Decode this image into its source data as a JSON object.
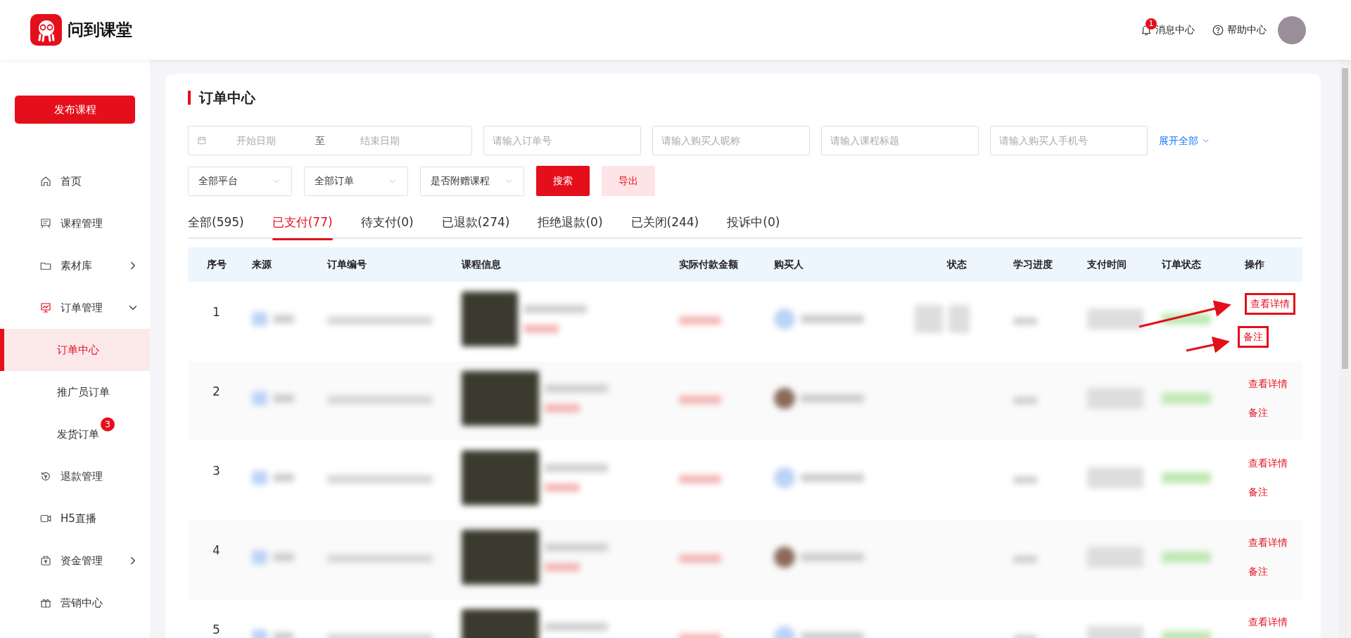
{
  "header": {
    "logo_text": "问到课堂",
    "notifications": {
      "label": "消息中心",
      "badge": "1"
    },
    "help": {
      "label": "帮助中心"
    }
  },
  "sidebar": {
    "publish_button": "发布课程",
    "items": [
      {
        "kind": "link",
        "label": "首页",
        "selected": false
      },
      {
        "kind": "link",
        "label": "课程管理",
        "selected": false
      },
      {
        "kind": "group",
        "label": "素材库",
        "selected": false,
        "expanded": false
      },
      {
        "kind": "group",
        "label": "订单管理",
        "selected": false,
        "expanded": true,
        "children": [
          {
            "label": "订单中心",
            "selected": true
          },
          {
            "label": "推广员订单",
            "selected": false
          },
          {
            "label": "发货订单",
            "selected": false,
            "badge": "3"
          }
        ]
      },
      {
        "kind": "link",
        "label": "退款管理",
        "selected": false
      },
      {
        "kind": "link",
        "label": "H5直播",
        "selected": false
      },
      {
        "kind": "group",
        "label": "资金管理",
        "selected": false,
        "expanded": false
      },
      {
        "kind": "link",
        "label": "营销中心",
        "selected": false
      }
    ]
  },
  "card": {
    "title": "订单中心",
    "date_range": {
      "start_placeholder": "开始日期",
      "separator": "至",
      "end_placeholder": "结束日期"
    },
    "inputs": [
      {
        "placeholder": "请输入订单号"
      },
      {
        "placeholder": "请输入购买人昵称"
      },
      {
        "placeholder": "请输入课程标题"
      },
      {
        "placeholder": "请输入购买人手机号"
      }
    ],
    "expand_link": "展开全部",
    "selects": [
      {
        "value": "全部平台"
      },
      {
        "value": "全部订单"
      },
      {
        "value": "是否附赠课程"
      }
    ],
    "search_button": "搜索",
    "export_button": "导出",
    "tabs": [
      {
        "label": "全部(595)",
        "selected": false
      },
      {
        "label": "已支付(77)",
        "selected": true
      },
      {
        "label": "待支付(0)",
        "selected": false
      },
      {
        "label": "已退款(274)",
        "selected": false
      },
      {
        "label": "拒绝退款(0)",
        "selected": false
      },
      {
        "label": "已关闭(244)",
        "selected": false
      },
      {
        "label": "投诉中(0)",
        "selected": false
      }
    ],
    "table": {
      "columns": [
        "序号",
        "来源",
        "订单编号",
        "课程信息",
        "实际付款金额",
        "购买人",
        "状态",
        "学习进度",
        "支付时间",
        "订单状态",
        "操作"
      ],
      "rows": [
        {
          "index": "1",
          "actions": [
            "查看详情",
            "备注"
          ],
          "annotated": true
        },
        {
          "index": "2",
          "actions": [
            "查看详情",
            "备注"
          ],
          "annotated": false
        },
        {
          "index": "3",
          "actions": [
            "查看详情",
            "备注"
          ],
          "annotated": false
        },
        {
          "index": "4",
          "actions": [
            "查看详情",
            "备注"
          ],
          "annotated": false
        },
        {
          "index": "5",
          "actions": [
            "查看详情"
          ],
          "annotated": false
        }
      ]
    }
  }
}
